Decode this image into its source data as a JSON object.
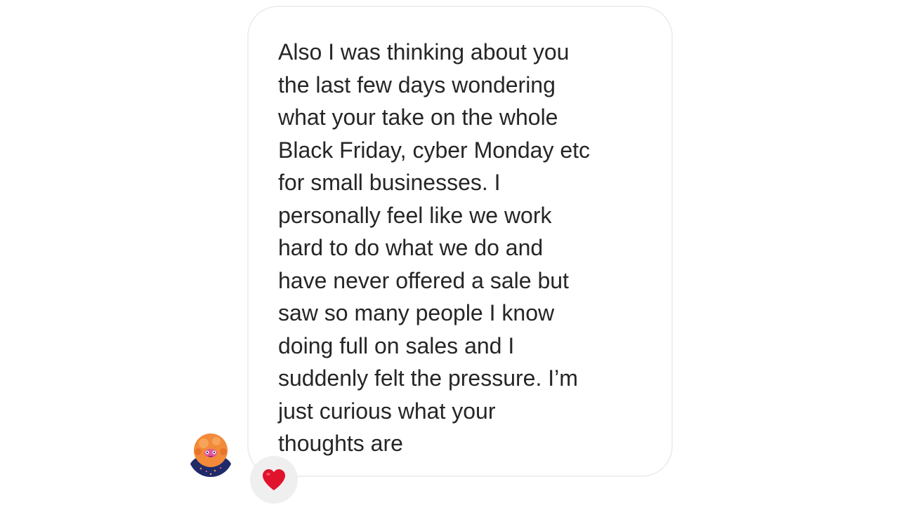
{
  "message": {
    "text": "Also I was thinking about you\nthe last few days wondering\nwhat your take on the whole\nBlack Friday, cyber Monday etc\nfor small businesses. I\npersonally feel like we work\nhard to do what we do and\nhave never offered a sale but\nsaw so many people I know\ndoing full on sales and I\nsuddenly felt the pressure. I’m\njust curious what your\nthoughts are",
    "reaction": "heart-icon",
    "reaction_color": "#e0122c"
  },
  "sender": {
    "avatar": "avatar-icon"
  },
  "colors": {
    "bubble_border": "#efefef",
    "text": "#262626",
    "reaction_bg": "#efefef"
  }
}
